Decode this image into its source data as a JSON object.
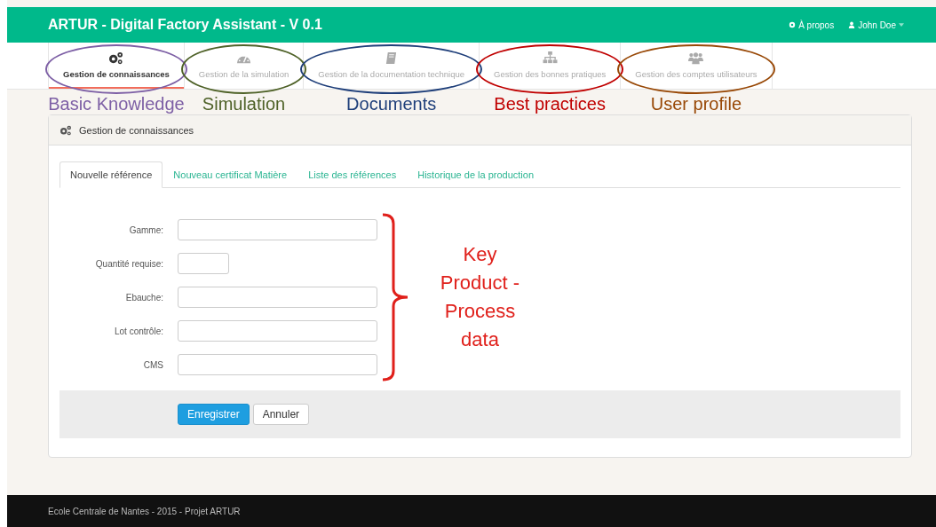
{
  "navbar": {
    "title": "ARTUR - Digital Factory Assistant - V 0.1",
    "links": [
      {
        "label": "À propos",
        "kind": "gear",
        "dropdown": false
      },
      {
        "label": "John Doe",
        "kind": "user",
        "dropdown": true
      }
    ]
  },
  "modules": [
    {
      "label": "Gestion de connaissances",
      "kind": "gears",
      "selected": true,
      "annotation": {
        "label": "Basic Knowledge",
        "color": "#7d5fa5"
      }
    },
    {
      "label": "Gestion de la simulation",
      "kind": "dashboard",
      "selected": false,
      "annotation": {
        "label": "Simulation",
        "color": "#4f6228"
      }
    },
    {
      "label": "Gestion de la documentation technique",
      "kind": "book",
      "selected": false,
      "annotation": {
        "label": "Documents",
        "color": "#1f3f7a"
      }
    },
    {
      "label": "Gestion des bonnes pratiques",
      "kind": "sitemap",
      "selected": false,
      "annotation": {
        "label": "Best practices",
        "color": "#c00000"
      }
    },
    {
      "label": "Gestion des comptes utilisateurs",
      "kind": "users",
      "selected": false,
      "annotation": {
        "label": "User profile",
        "color": "#984806"
      }
    }
  ],
  "panel": {
    "title": "Gestion de connaissances",
    "tabs": [
      {
        "label": "Nouvelle référence",
        "selected": true
      },
      {
        "label": "Nouveau certificat Matière",
        "selected": false
      },
      {
        "label": "Liste des références",
        "selected": false
      },
      {
        "label": "Historique de la production",
        "selected": false
      }
    ],
    "fields": [
      {
        "label": "Gamme:",
        "kind": "wide"
      },
      {
        "label": "Quantité requise:",
        "kind": "short"
      },
      {
        "label": "Ebauche:",
        "kind": "wide"
      },
      {
        "label": "Lot contrôle:",
        "kind": "wide"
      },
      {
        "label": "CMS",
        "kind": "wide"
      }
    ],
    "annotation": {
      "label": "Key Product - Process data",
      "color": "#e0201b"
    },
    "buttons": [
      {
        "label": "Enregistrer",
        "kind": "primary"
      },
      {
        "label": "Annuler",
        "kind": "default"
      }
    ]
  },
  "footer": {
    "text": "Ecole Centrale de Nantes - 2015 - Projet ARTUR"
  }
}
